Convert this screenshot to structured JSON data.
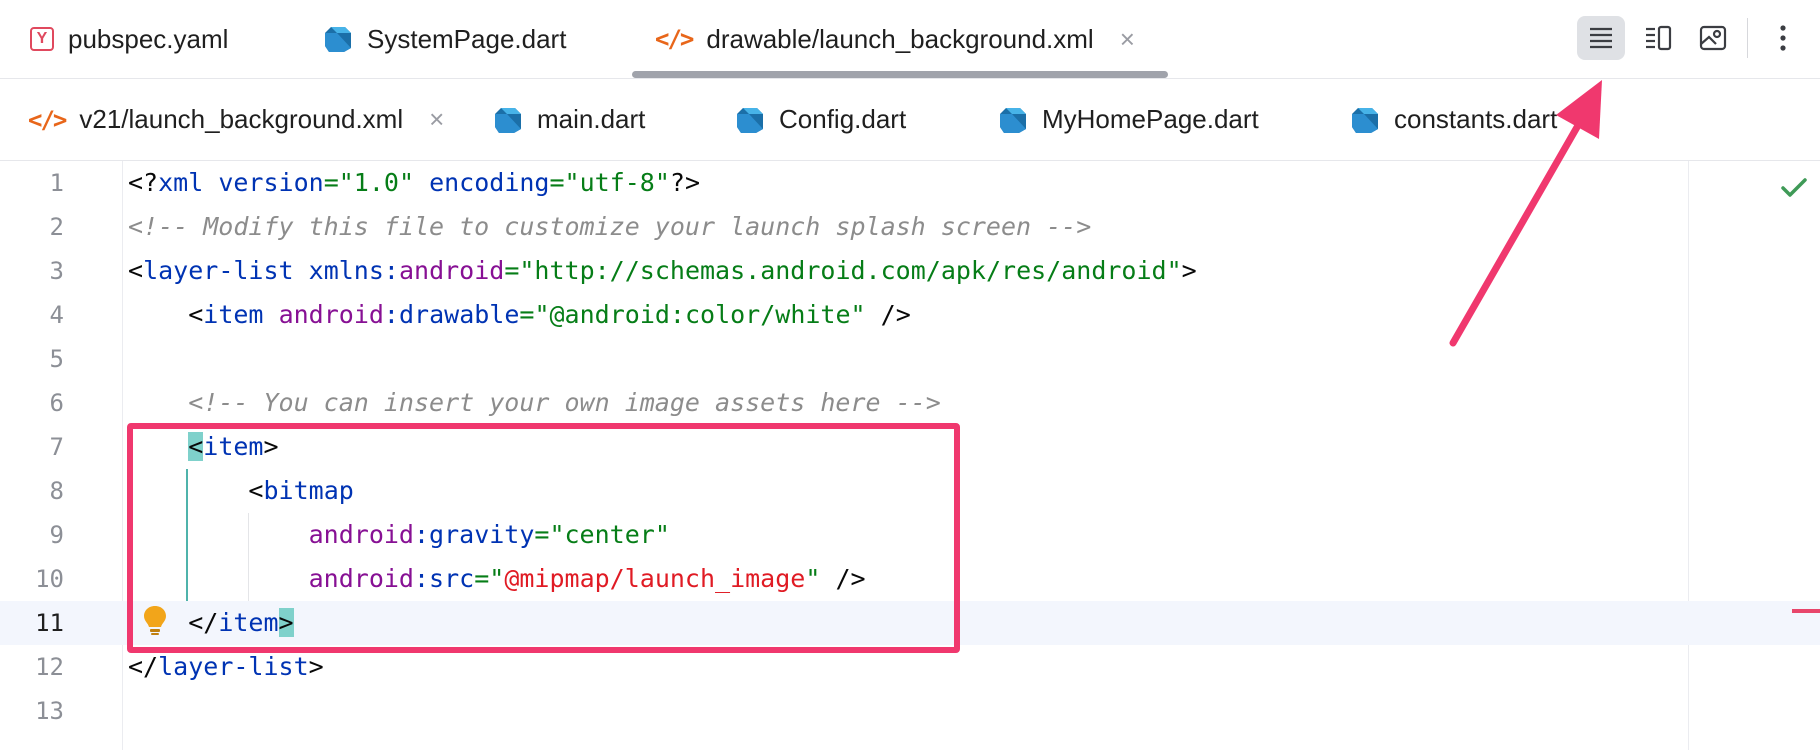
{
  "tabs_row1": [
    {
      "label": "pubspec.yaml",
      "icon": "yaml-file-icon"
    },
    {
      "label": "SystemPage.dart",
      "icon": "dart-file-icon"
    },
    {
      "label": "drawable/launch_background.xml",
      "icon": "xml-file-icon",
      "active": true,
      "close": "×"
    }
  ],
  "tabs_row2": [
    {
      "label": "v21/launch_background.xml",
      "icon": "xml-file-icon",
      "close": "×"
    },
    {
      "label": "main.dart",
      "icon": "dart-file-icon"
    },
    {
      "label": "Config.dart",
      "icon": "dart-file-icon"
    },
    {
      "label": "MyHomePage.dart",
      "icon": "dart-file-icon"
    },
    {
      "label": "constants.dart",
      "icon": "dart-file-icon"
    }
  ],
  "toolbar": {
    "view_modes": [
      "code-view-icon",
      "split-view-icon",
      "design-view-icon"
    ],
    "active_view": "code-view-icon",
    "more": "more-vertical-icon"
  },
  "editor": {
    "current_line": 11,
    "line_numbers": [
      "1",
      "2",
      "3",
      "4",
      "5",
      "6",
      "7",
      "8",
      "9",
      "10",
      "11",
      "12",
      "13"
    ],
    "lines": {
      "l1": {
        "a": "<?",
        "b": "xml",
        "c": "version",
        "d": "=\"1.0\"",
        "e": "encoding",
        "f": "=\"utf-8\"",
        "g": "?>"
      },
      "l2": {
        "comment": "<!-- Modify this file to customize your launch splash screen -->"
      },
      "l3": {
        "a": "<",
        "b": "layer-list",
        "c": "xmlns",
        "d": ":",
        "e": "android",
        "f": "=\"http://schemas.android.com/apk/res/android\"",
        "g": ">"
      },
      "l4": {
        "a": "<",
        "b": "item",
        "c": "android",
        "d": ":",
        "e": "drawable",
        "f": "=\"@android:color/white\"",
        "g": " />"
      },
      "l6": {
        "comment": "<!-- You can insert your own image assets here -->"
      },
      "l7": {
        "a": "<",
        "b": "item",
        "c": ">"
      },
      "l8": {
        "a": "<",
        "b": "bitmap"
      },
      "l9": {
        "a": "android",
        "b": ":",
        "c": "gravity",
        "d": "=\"center\""
      },
      "l10": {
        "a": "android",
        "b": ":",
        "c": "src",
        "d": "=\"",
        "e": "@mipmap/launch_image",
        "f": "\"",
        "g": " />"
      },
      "l11": {
        "a": "</",
        "b": "item",
        "c": ">"
      },
      "l12": {
        "a": "</",
        "b": "layer-list",
        "c": ">"
      }
    },
    "status_icon": "check-icon",
    "intention_icon": "lightbulb-icon"
  },
  "colors": {
    "annotation": "#f0386e",
    "tag": "#0033b3",
    "attribute_ns": "#871094",
    "value": "#067d17",
    "error_value": "#e01b24",
    "comment": "#8c8c8c"
  }
}
